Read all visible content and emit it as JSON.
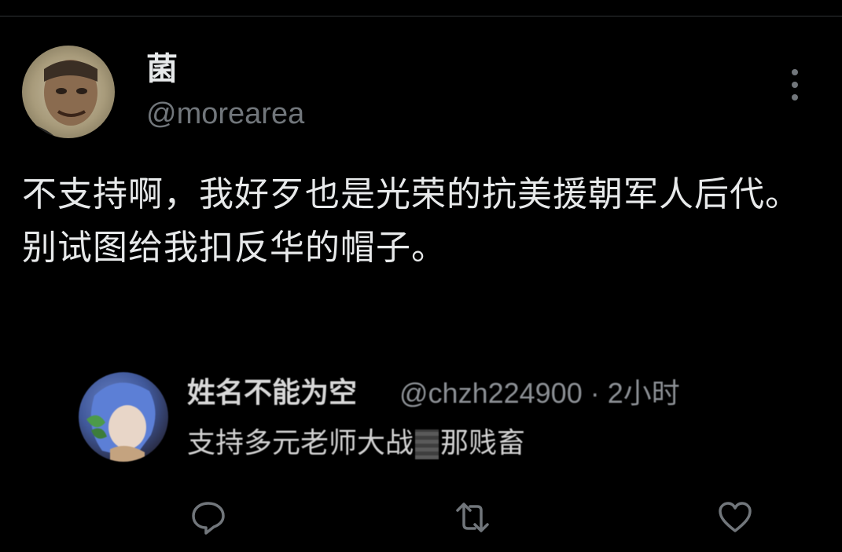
{
  "post": {
    "display_name": "菌",
    "handle": "@morearea",
    "text": "不支持啊，我好歹也是光荣的抗美援朝军人后代。别试图给我扣反华的帽子。"
  },
  "quoted_reply": {
    "display_name": "姓名不能为空",
    "meta": "@chzh224900 · 2小时",
    "text_before": "支持多元老师大战",
    "text_after": "那贱畜"
  },
  "actions": {
    "reply_icon": "reply-icon",
    "retweet_icon": "retweet-icon",
    "like_icon": "heart-icon"
  },
  "colors": {
    "background": "#000000",
    "primary_text": "#e7e9ea",
    "secondary_text": "#71767b"
  }
}
